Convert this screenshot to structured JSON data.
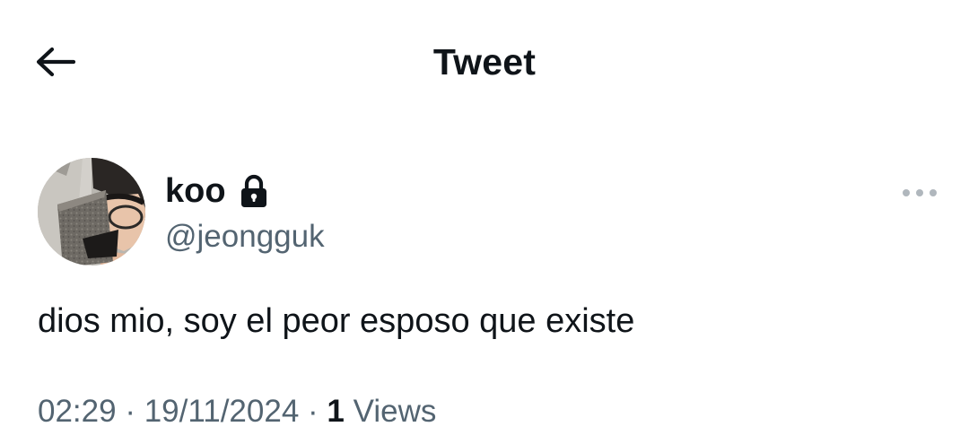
{
  "header": {
    "title": "Tweet",
    "back_icon": "arrow-left-icon"
  },
  "tweet": {
    "author": {
      "name": "koo",
      "handle": "@jeongguk",
      "protected_icon": "lock-icon",
      "avatar_icon": "avatar-photo"
    },
    "more_icon": "more-horizontal-icon",
    "text": "dios mio, soy el peor esposo que existe",
    "meta": {
      "time": "02:29",
      "separator": "·",
      "date": "19/11/2024",
      "views_count": "1",
      "views_label": "Views"
    }
  },
  "colors": {
    "primary_text": "#0f1419",
    "secondary_text": "#536471",
    "background": "#ffffff"
  }
}
